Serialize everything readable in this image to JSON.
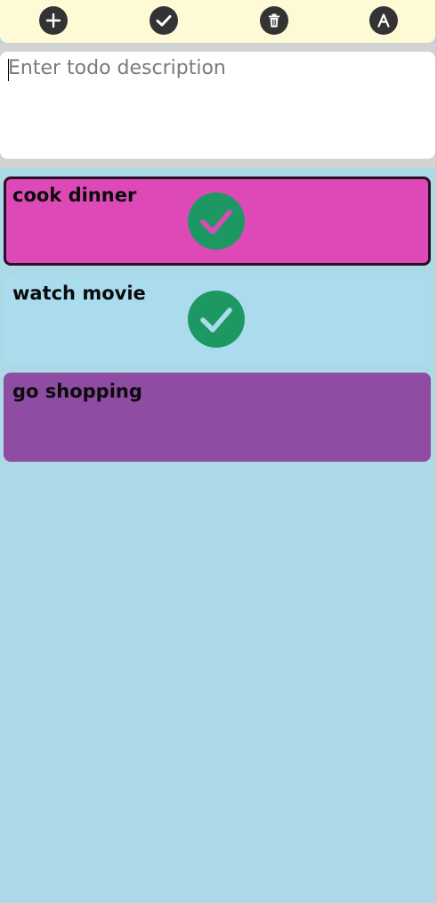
{
  "toolbar": {
    "buttons": [
      {
        "name": "add",
        "icon": "plus-circle-icon"
      },
      {
        "name": "mark-done",
        "icon": "check-circle-icon"
      },
      {
        "name": "delete",
        "icon": "trash-icon"
      },
      {
        "name": "sort",
        "icon": "letter-a-icon"
      }
    ],
    "background": "#fffad6",
    "button_color": "#333333"
  },
  "input": {
    "placeholder": "Enter todo description",
    "value": ""
  },
  "todos": [
    {
      "label": "cook dinner",
      "done": true,
      "color": "#dd4ab8",
      "selected": true
    },
    {
      "label": "watch movie",
      "done": true,
      "color": "#aadcee",
      "selected": false
    },
    {
      "label": "go shopping",
      "done": false,
      "color": "#8e4ca3",
      "selected": false
    }
  ],
  "colors": {
    "list_background": "#add8e6",
    "check_circle": "#1e9862"
  }
}
